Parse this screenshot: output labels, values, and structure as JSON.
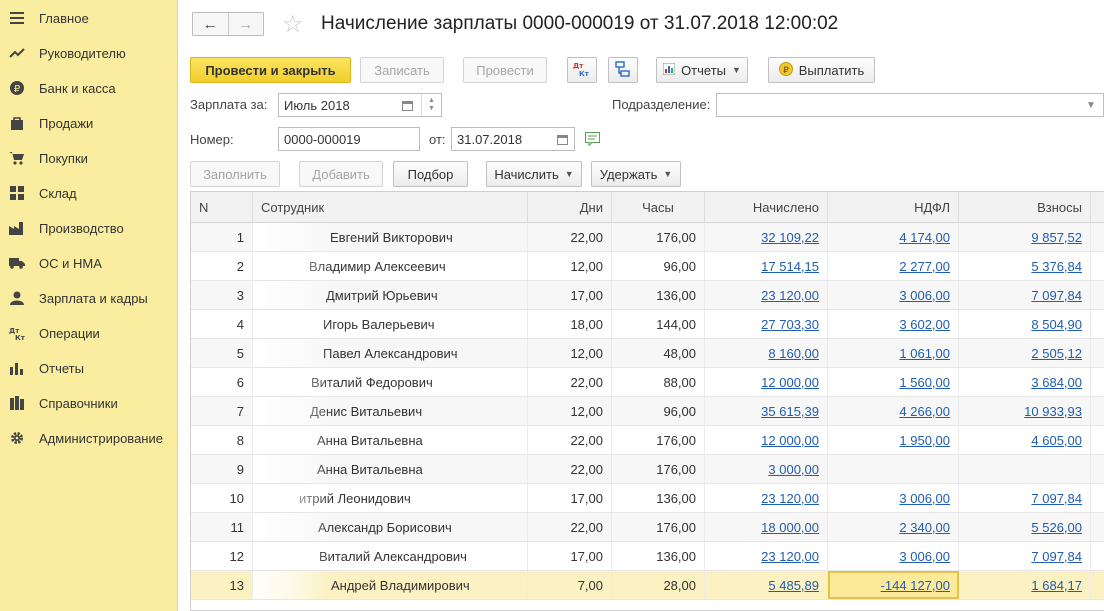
{
  "sidebar": {
    "items": [
      {
        "label": "Главное",
        "icon": "menu-icon"
      },
      {
        "label": "Руководителю",
        "icon": "trend-icon"
      },
      {
        "label": "Банк и касса",
        "icon": "ruble-coin-icon"
      },
      {
        "label": "Продажи",
        "icon": "bag-icon"
      },
      {
        "label": "Покупки",
        "icon": "cart-icon"
      },
      {
        "label": "Склад",
        "icon": "grid-icon"
      },
      {
        "label": "Производство",
        "icon": "factory-icon"
      },
      {
        "label": "ОС и НМА",
        "icon": "truck-icon"
      },
      {
        "label": "Зарплата и кадры",
        "icon": "person-icon"
      },
      {
        "label": "Операции",
        "icon": "dt-kt-icon"
      },
      {
        "label": "Отчеты",
        "icon": "bar-chart-icon"
      },
      {
        "label": "Справочники",
        "icon": "books-icon"
      },
      {
        "label": "Администрирование",
        "icon": "gear-icon"
      }
    ]
  },
  "header": {
    "title": "Начисление зарплаты 0000-000019 от 31.07.2018 12:00:02"
  },
  "toolbar": {
    "post_close": "Провести и закрыть",
    "save": "Записать",
    "post": "Провести",
    "reports": "Отчеты",
    "pay": "Выплатить"
  },
  "form": {
    "salary_for_label": "Зарплата за:",
    "salary_for_value": "Июль 2018",
    "department_label": "Подразделение:",
    "department_value": "",
    "number_label": "Номер:",
    "number_value": "0000-000019",
    "date_label": "от:",
    "date_value": "31.07.2018"
  },
  "table_toolbar": {
    "fill": "Заполнить",
    "add": "Добавить",
    "pick": "Подбор",
    "accrue": "Начислить",
    "withhold": "Удержать"
  },
  "table": {
    "headers": [
      "N",
      "Сотрудник",
      "Дни",
      "Часы",
      "Начислено",
      "НДФЛ",
      "Взносы"
    ],
    "rows": [
      {
        "n": "1",
        "employee": "Евгений Викторович",
        "days": "22,00",
        "hours": "176,00",
        "accrued": "32 109,22",
        "ndfl": "4 174,00",
        "contrib": "9 857,52"
      },
      {
        "n": "2",
        "employee": "Владимир Алексеевич",
        "days": "12,00",
        "hours": "96,00",
        "accrued": "17 514,15",
        "ndfl": "2 277,00",
        "contrib": "5 376,84"
      },
      {
        "n": "3",
        "employee": "Дмитрий Юрьевич",
        "days": "17,00",
        "hours": "136,00",
        "accrued": "23 120,00",
        "ndfl": "3 006,00",
        "contrib": "7 097,84"
      },
      {
        "n": "4",
        "employee": "Игорь Валерьевич",
        "days": "18,00",
        "hours": "144,00",
        "accrued": "27 703,30",
        "ndfl": "3 602,00",
        "contrib": "8 504,90"
      },
      {
        "n": "5",
        "employee": "Павел Александрович",
        "days": "12,00",
        "hours": "48,00",
        "accrued": "8 160,00",
        "ndfl": "1 061,00",
        "contrib": "2 505,12"
      },
      {
        "n": "6",
        "employee": "Виталий Федорович",
        "days": "22,00",
        "hours": "88,00",
        "accrued": "12 000,00",
        "ndfl": "1 560,00",
        "contrib": "3 684,00"
      },
      {
        "n": "7",
        "employee": "Денис Витальевич",
        "days": "12,00",
        "hours": "96,00",
        "accrued": "35 615,39",
        "ndfl": "4 266,00",
        "contrib": "10 933,93"
      },
      {
        "n": "8",
        "employee": "Анна Витальевна",
        "days": "22,00",
        "hours": "176,00",
        "accrued": "12 000,00",
        "ndfl": "1 950,00",
        "contrib": "4 605,00"
      },
      {
        "n": "9",
        "employee": "Анна Витальевна",
        "days": "22,00",
        "hours": "176,00",
        "accrued": "3 000,00",
        "ndfl": "",
        "contrib": ""
      },
      {
        "n": "10",
        "employee": "итрий Леонидович",
        "days": "17,00",
        "hours": "136,00",
        "accrued": "23 120,00",
        "ndfl": "3 006,00",
        "contrib": "7 097,84"
      },
      {
        "n": "11",
        "employee": "Александр Борисович",
        "days": "22,00",
        "hours": "176,00",
        "accrued": "18 000,00",
        "ndfl": "2 340,00",
        "contrib": "5 526,00"
      },
      {
        "n": "12",
        "employee": "Виталий Александрович",
        "days": "17,00",
        "hours": "136,00",
        "accrued": "23 120,00",
        "ndfl": "3 006,00",
        "contrib": "7 097,84"
      },
      {
        "n": "13",
        "employee": "Андрей Владимирович",
        "days": "7,00",
        "hours": "28,00",
        "accrued": "5 485,89",
        "ndfl": "-144 127,00",
        "contrib": "1 684,17"
      }
    ]
  },
  "colors": {
    "sidebar_bg": "#fbeda0",
    "primary_button": "#f1cf2a",
    "link": "#1f5db1",
    "selected_row": "#fbf1c2"
  }
}
